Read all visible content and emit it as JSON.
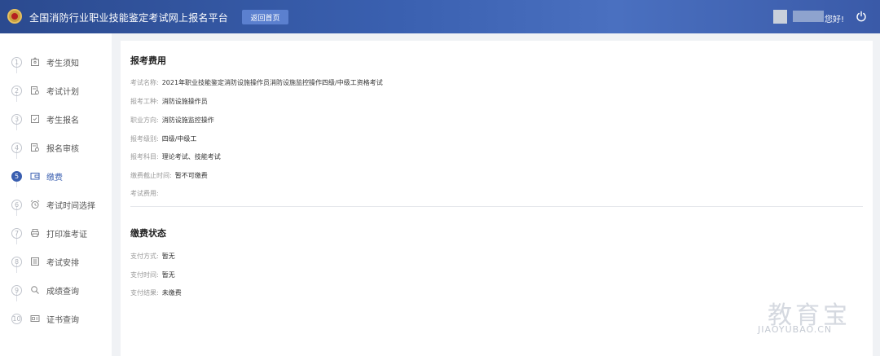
{
  "header": {
    "title": "全国消防行业职业技能鉴定考试网上报名平台",
    "home_button": "返回首页",
    "greeting": "您好!",
    "logo_icon": "fire-emblem-icon",
    "power_icon": "power-icon"
  },
  "sidebar": {
    "active_index": 4,
    "items": [
      {
        "num": "1",
        "label": "考生须知",
        "icon": "notice-icon"
      },
      {
        "num": "2",
        "label": "考试计划",
        "icon": "plan-icon"
      },
      {
        "num": "3",
        "label": "考生报名",
        "icon": "signup-icon"
      },
      {
        "num": "4",
        "label": "报名审核",
        "icon": "review-icon"
      },
      {
        "num": "5",
        "label": "缴费",
        "icon": "wallet-icon"
      },
      {
        "num": "6",
        "label": "考试时间选择",
        "icon": "alarm-clock-icon"
      },
      {
        "num": "7",
        "label": "打印准考证",
        "icon": "printer-icon"
      },
      {
        "num": "8",
        "label": "考试安排",
        "icon": "schedule-icon"
      },
      {
        "num": "9",
        "label": "成绩查询",
        "icon": "search-icon"
      },
      {
        "num": "10",
        "label": "证书查询",
        "icon": "certificate-icon"
      }
    ]
  },
  "fee": {
    "title": "报考费用",
    "rows": [
      {
        "key": "考试名称:",
        "value": "2021年职业技能鉴定消防设施操作员消防设施监控操作四级/中级工资格考试"
      },
      {
        "key": "报考工种:",
        "value": "消防设施操作员"
      },
      {
        "key": "职业方向:",
        "value": "消防设施监控操作"
      },
      {
        "key": "报考级别:",
        "value": "四级/中级工"
      },
      {
        "key": "报考科目:",
        "value": "理论考试、技能考试"
      },
      {
        "key": "缴费截止时间:",
        "value": "暂不可缴费"
      },
      {
        "key": "考试费用:",
        "value": ""
      }
    ]
  },
  "payment": {
    "title": "缴费状态",
    "rows": [
      {
        "key": "支付方式:",
        "value": "暂无"
      },
      {
        "key": "支付时间:",
        "value": "暂无"
      },
      {
        "key": "支付结果:",
        "value": "未缴费"
      }
    ]
  },
  "watermark": {
    "cn": "教育宝",
    "en": "JIAOYUBAO.CN"
  },
  "colors": {
    "header": "#3a60b0",
    "accent": "#3a5fb0",
    "background": "#f0f2f5"
  }
}
